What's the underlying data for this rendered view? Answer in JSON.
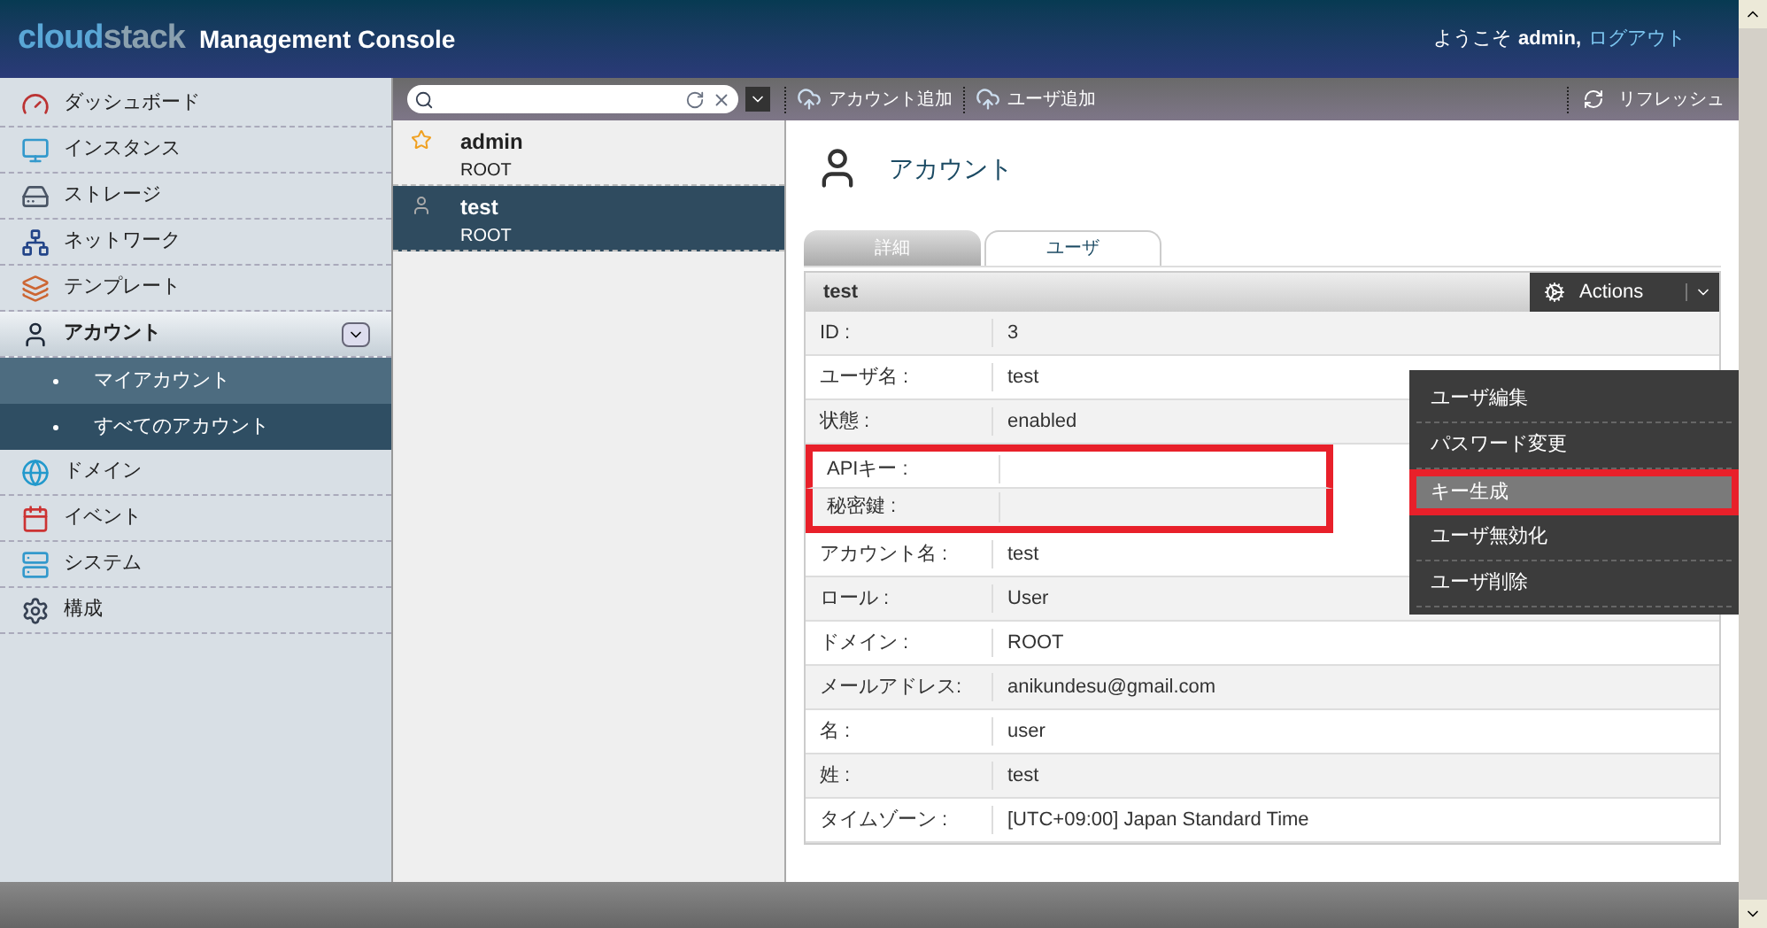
{
  "header": {
    "logo_first": "cloud",
    "logo_second": "stack",
    "title": "Management Console",
    "greeting": "ようこそ",
    "user": "admin,",
    "logout": "ログアウト"
  },
  "sidebar": {
    "items": [
      {
        "label": "ダッシュボード",
        "selected": false
      },
      {
        "label": "インスタンス",
        "selected": false
      },
      {
        "label": "ストレージ",
        "selected": false
      },
      {
        "label": "ネットワーク",
        "selected": false
      },
      {
        "label": "テンプレート",
        "selected": false
      },
      {
        "label": "アカウント",
        "selected": true,
        "expanded": true,
        "children": [
          {
            "label": "マイアカウント",
            "selected": true
          },
          {
            "label": "すべてのアカウント",
            "selected": false
          }
        ]
      },
      {
        "label": "ドメイン",
        "selected": false
      },
      {
        "label": "イベント",
        "selected": false
      },
      {
        "label": "システム",
        "selected": false
      },
      {
        "label": "構成",
        "selected": false
      }
    ]
  },
  "toolbar": {
    "buttons": [
      "アカウント追加",
      "ユーザ追加"
    ],
    "refresh": "リフレッシュ"
  },
  "list": [
    {
      "name": "admin",
      "domain": "ROOT",
      "selected": false,
      "kind": "admin"
    },
    {
      "name": "test",
      "domain": "ROOT",
      "selected": true,
      "kind": "user"
    }
  ],
  "detail": {
    "title": "アカウント",
    "tabs": [
      {
        "label": "詳細",
        "selected": false
      },
      {
        "label": "ユーザ",
        "selected": true
      }
    ],
    "panel_title": "test",
    "actions": "Actions",
    "menu": [
      {
        "label": "ユーザ編集",
        "highlighted": false
      },
      {
        "label": "パスワード変更",
        "highlighted": false
      },
      {
        "label": "キー生成",
        "highlighted": true
      },
      {
        "label": "ユーザ無効化",
        "highlighted": false
      },
      {
        "label": "ユーザ削除",
        "highlighted": false
      }
    ],
    "rows": [
      {
        "label": "ID :",
        "value": "3",
        "highlighted": false
      },
      {
        "label": "ユーザ名 :",
        "value": "test",
        "highlighted": false
      },
      {
        "label": "状態 :",
        "value": "enabled",
        "highlighted": false
      },
      {
        "label": "APIキー :",
        "highlighted": true
      },
      {
        "label": "秘密鍵 :",
        "highlighted": true
      },
      {
        "label": "アカウント名 :",
        "value": "test",
        "highlighted": false
      },
      {
        "label": "ロール :",
        "value": "User",
        "highlighted": false
      },
      {
        "label": "ドメイン :",
        "value": "ROOT",
        "highlighted": false
      },
      {
        "label": "メールアドレス:",
        "value": "anikundesu@gmail.com",
        "highlighted": false
      },
      {
        "label": "名 :",
        "value": "user",
        "highlighted": false
      },
      {
        "label": "姓 :",
        "value": "test",
        "highlighted": false
      },
      {
        "label": "タイムゾーン :",
        "value": "[UTC+09:00] Japan Standard Time",
        "highlighted": false
      }
    ]
  }
}
